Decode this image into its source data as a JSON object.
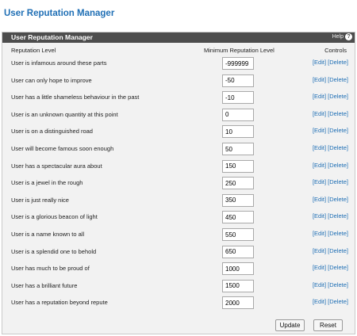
{
  "page_title": "User Reputation Manager",
  "panel": {
    "title": "User Reputation Manager",
    "help_label": "Help",
    "help_icon": "help-circle-icon"
  },
  "columns": {
    "level": "Reputation Level",
    "minimum": "Minimum Reputation Level",
    "controls": "Controls"
  },
  "controls": {
    "edit": "[Edit]",
    "delete": "[Delete]"
  },
  "rows": [
    {
      "label": "User is infamous around these parts",
      "value": "-999999"
    },
    {
      "label": "User can only hope to improve",
      "value": "-50"
    },
    {
      "label": "User has a little shameless behaviour in the past",
      "value": "-10"
    },
    {
      "label": "User is an unknown quantity at this point",
      "value": "0"
    },
    {
      "label": "User is on a distinguished road",
      "value": "10"
    },
    {
      "label": "User will become famous soon enough",
      "value": "50"
    },
    {
      "label": "User has a spectacular aura about",
      "value": "150"
    },
    {
      "label": "User is a jewel in the rough",
      "value": "250"
    },
    {
      "label": "User is just really nice",
      "value": "350"
    },
    {
      "label": "User is a glorious beacon of light",
      "value": "450"
    },
    {
      "label": "User is a name known to all",
      "value": "550"
    },
    {
      "label": "User is a splendid one to behold",
      "value": "650"
    },
    {
      "label": "User has much to be proud of",
      "value": "1000"
    },
    {
      "label": "User has a brilliant future",
      "value": "1500"
    },
    {
      "label": "User has a reputation beyond repute",
      "value": "2000"
    }
  ],
  "buttons": {
    "update": "Update",
    "reset": "Reset"
  }
}
